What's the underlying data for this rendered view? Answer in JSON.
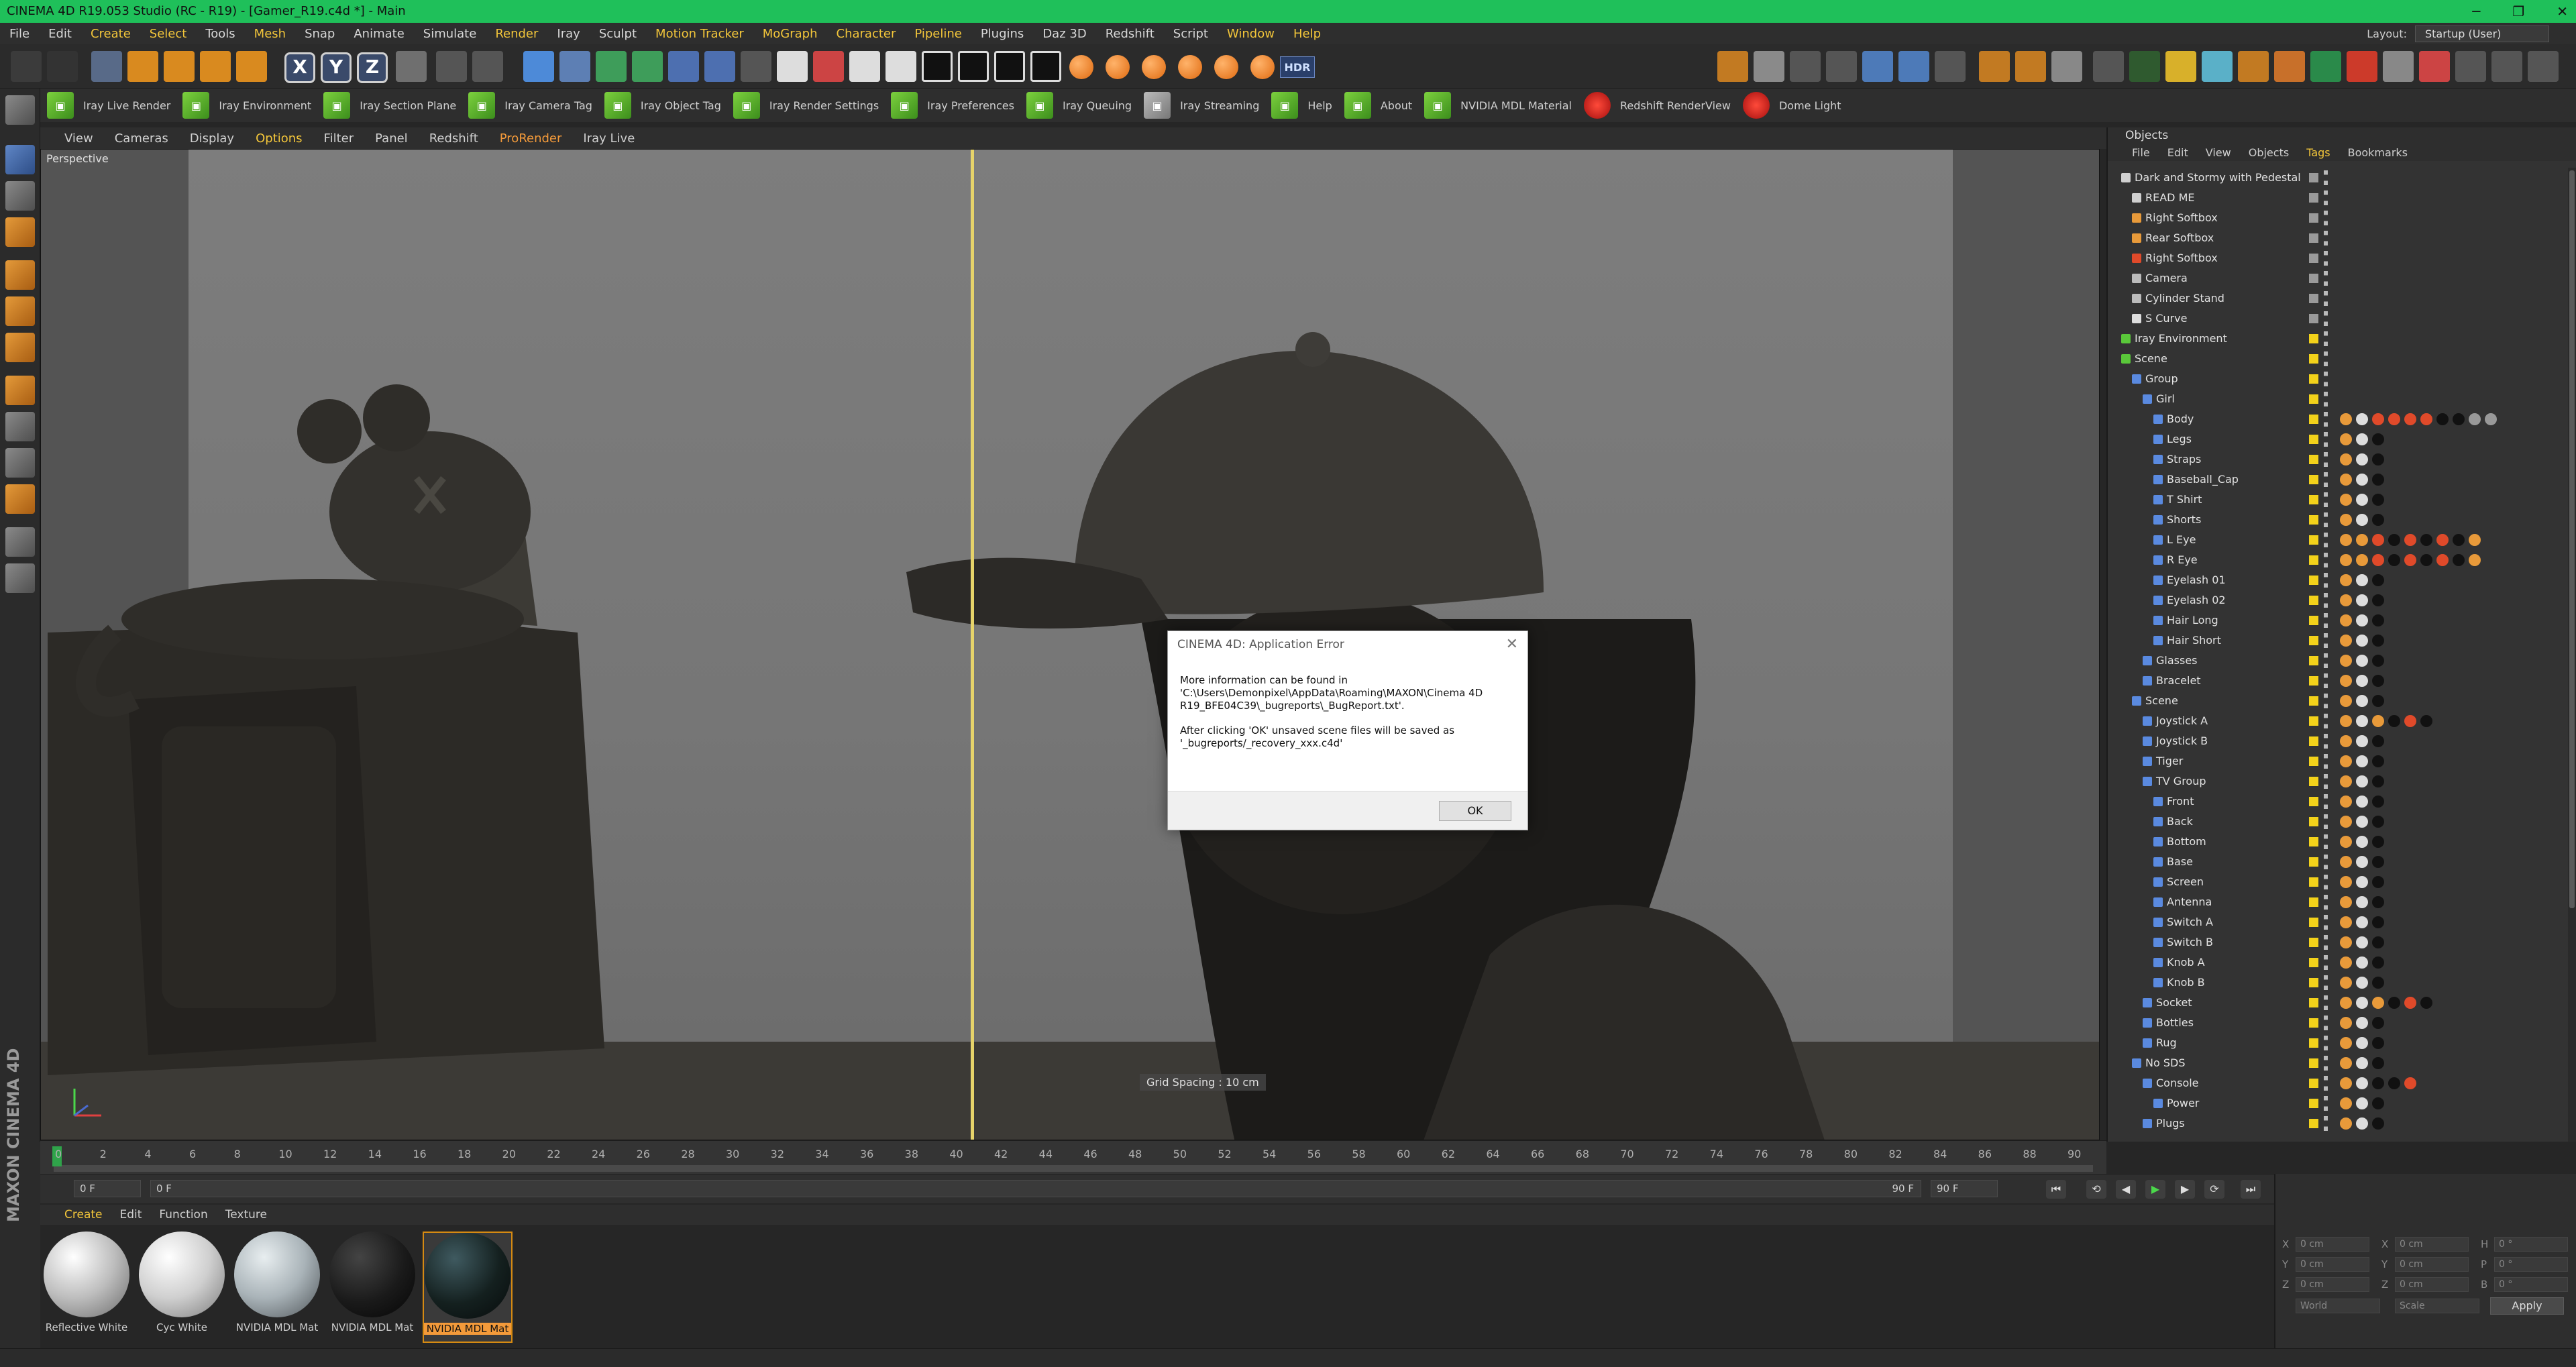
{
  "window": {
    "title": "CINEMA 4D R19.053 Studio (RC - R19) - [Gamer_R19.c4d *] - Main"
  },
  "menu": [
    "File",
    "Edit",
    "Create",
    "Select",
    "Tools",
    "Mesh",
    "Snap",
    "Animate",
    "Simulate",
    "Render",
    "Iray",
    "Sculpt",
    "Motion Tracker",
    "MoGraph",
    "Character",
    "Pipeline",
    "Plugins",
    "Daz 3D",
    "Redshift",
    "Script",
    "Window",
    "Help"
  ],
  "layout": {
    "label": "Layout:",
    "value": "Startup (User)"
  },
  "toolbar": {
    "xyz": [
      "X",
      "Y",
      "Z"
    ],
    "hdr": "HDR"
  },
  "plugins": [
    {
      "label": "Iray Live Render"
    },
    {
      "label": "Iray Environment"
    },
    {
      "label": "Iray Section Plane"
    },
    {
      "label": "Iray Camera Tag"
    },
    {
      "label": "Iray Object Tag"
    },
    {
      "label": "Iray Render Settings"
    },
    {
      "label": "Iray Preferences"
    },
    {
      "label": "Iray Queuing"
    },
    {
      "label": "Iray Streaming"
    },
    {
      "label": "Help"
    },
    {
      "label": "About"
    },
    {
      "label": "NVIDIA MDL Material"
    },
    {
      "label": "Redshift RenderView"
    },
    {
      "label": "Dome Light"
    }
  ],
  "viewport": {
    "menu": [
      "View",
      "Cameras",
      "Display",
      "Options",
      "Filter",
      "Panel",
      "Redshift",
      "ProRender",
      "Iray Live"
    ],
    "label": "Perspective",
    "grid_spacing": "Grid Spacing : 10 cm"
  },
  "dialog": {
    "title": "CINEMA 4D: Application Error",
    "line1": "More information can be found in",
    "line2": "'C:\\Users\\Demonpixel\\AppData\\Roaming\\MAXON\\Cinema 4D",
    "line3": "R19_BFE04C39\\_bugreports\\_BugReport.txt'.",
    "line4": "After clicking 'OK' unsaved scene files will be saved as",
    "line5": "'_bugreports/_recovery_xxx.c4d'",
    "ok": "OK"
  },
  "timeline": {
    "ticks": [
      "0",
      "2",
      "4",
      "6",
      "8",
      "10",
      "12",
      "14",
      "16",
      "18",
      "20",
      "22",
      "24",
      "26",
      "28",
      "30",
      "32",
      "34",
      "36",
      "38",
      "40",
      "42",
      "44",
      "46",
      "48",
      "50",
      "52",
      "54",
      "56",
      "58",
      "60",
      "62",
      "64",
      "66",
      "68",
      "70",
      "72",
      "74",
      "76",
      "78",
      "80",
      "82",
      "84",
      "86",
      "88",
      "90"
    ],
    "current_frame": "0 F",
    "start_field": "0 F",
    "end_field": "90 F",
    "range_end": "90 F"
  },
  "materials": {
    "menu": [
      "Create",
      "Edit",
      "Function",
      "Texture"
    ],
    "items": [
      {
        "label": "Reflective White"
      },
      {
        "label": "Cyc White"
      },
      {
        "label": "NVIDIA MDL Mat"
      },
      {
        "label": "NVIDIA MDL Mat"
      },
      {
        "label": "NVIDIA MDL Mat"
      }
    ]
  },
  "objects": {
    "title": "Objects",
    "menu": [
      "File",
      "Edit",
      "View",
      "Objects",
      "Tags",
      "Bookmarks"
    ],
    "rows": [
      {
        "name": "Dark and Stormy with Pedestal"
      },
      {
        "name": "READ ME"
      },
      {
        "name": "Right Softbox"
      },
      {
        "name": "Rear Softbox"
      },
      {
        "name": "Right Softbox"
      },
      {
        "name": "Camera"
      },
      {
        "name": "Cylinder Stand"
      },
      {
        "name": "S Curve"
      },
      {
        "name": "Iray Environment"
      },
      {
        "name": "Scene"
      },
      {
        "name": "Group"
      },
      {
        "name": "Girl"
      },
      {
        "name": "Body"
      },
      {
        "name": "Legs"
      },
      {
        "name": "Straps"
      },
      {
        "name": "Baseball_Cap"
      },
      {
        "name": "T Shirt"
      },
      {
        "name": "Shorts"
      },
      {
        "name": "L Eye"
      },
      {
        "name": "R Eye"
      },
      {
        "name": "Eyelash 01"
      },
      {
        "name": "Eyelash 02"
      },
      {
        "name": "Hair Long"
      },
      {
        "name": "Hair Short"
      },
      {
        "name": "Glasses"
      },
      {
        "name": "Bracelet"
      },
      {
        "name": "Scene"
      },
      {
        "name": "Joystick A"
      },
      {
        "name": "Joystick B"
      },
      {
        "name": "Tiger"
      },
      {
        "name": "TV Group"
      },
      {
        "name": "Front"
      },
      {
        "name": "Back"
      },
      {
        "name": "Bottom"
      },
      {
        "name": "Base"
      },
      {
        "name": "Screen"
      },
      {
        "name": "Antenna"
      },
      {
        "name": "Switch A"
      },
      {
        "name": "Switch B"
      },
      {
        "name": "Knob A"
      },
      {
        "name": "Knob B"
      },
      {
        "name": "Socket"
      },
      {
        "name": "Bottles"
      },
      {
        "name": "Rug"
      },
      {
        "name": "No SDS"
      },
      {
        "name": "Console"
      },
      {
        "name": "Power"
      },
      {
        "name": "Plugs"
      }
    ]
  },
  "coords": {
    "x": "X",
    "y": "Y",
    "z": "Z",
    "h": "H",
    "p": "P",
    "b": "B",
    "zero_cm": "0 cm",
    "zero_deg": "0 °",
    "world": "World",
    "scale": "Scale",
    "apply": "Apply"
  },
  "brand": "MAXON CINEMA 4D"
}
